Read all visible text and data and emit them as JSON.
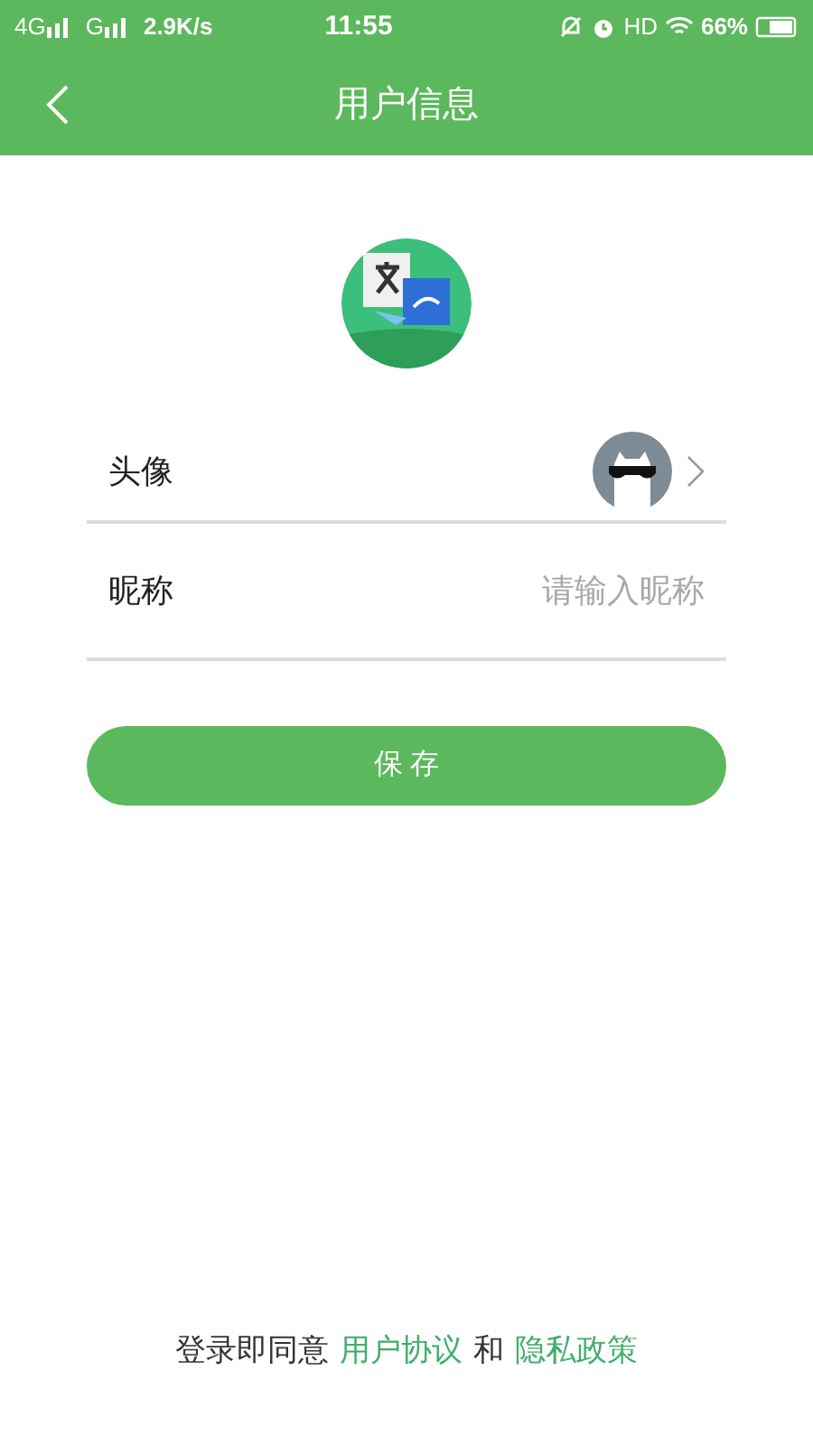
{
  "status_bar": {
    "network_1": "4G",
    "network_2": "G",
    "speed": "2.9K/s",
    "time": "11:55",
    "hd": "HD",
    "battery": "66%"
  },
  "header": {
    "title": "用户信息"
  },
  "form": {
    "avatar_label": "头像",
    "nickname_label": "昵称",
    "nickname_placeholder": "请输入昵称"
  },
  "save_button": "保 存",
  "footer": {
    "text": "登录即同意",
    "link_1": "用户协议",
    "joiner": "和",
    "link_2": "隐私政策"
  }
}
